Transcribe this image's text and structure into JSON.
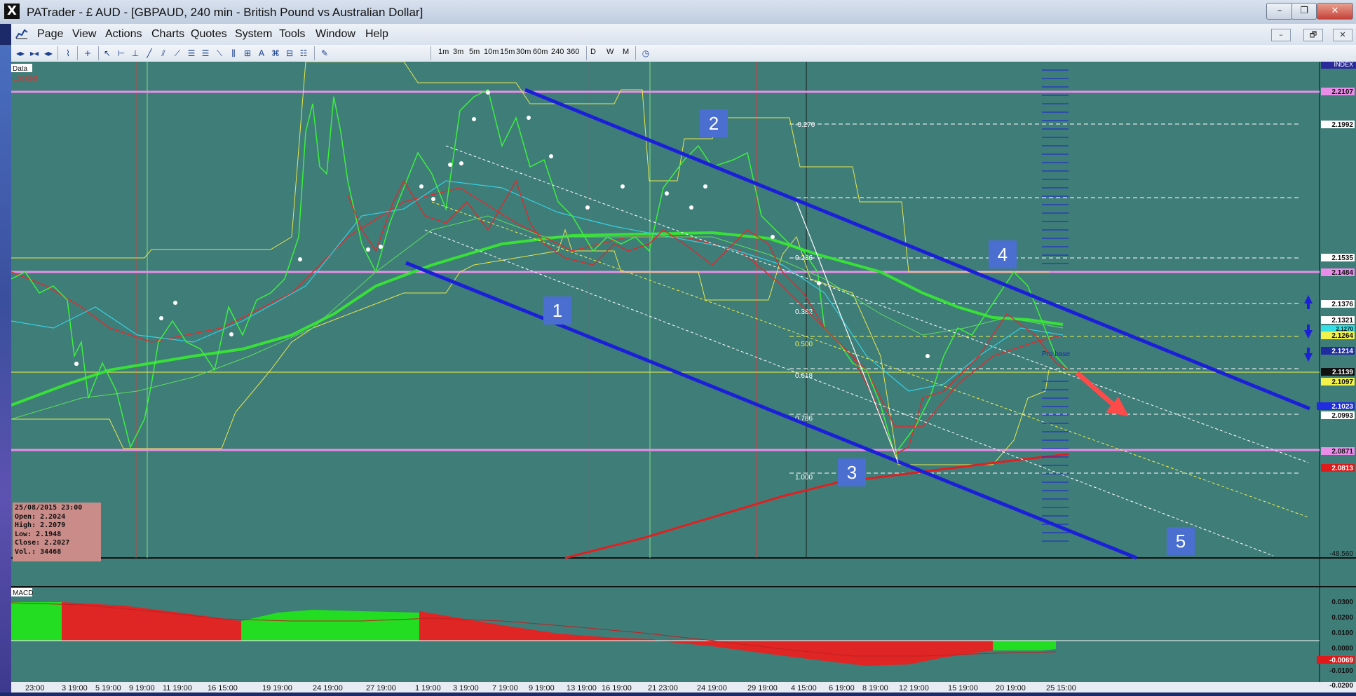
{
  "window": {
    "title": "PATrader - £ AUD - [GBPAUD, 240 min - British Pound vs Australian Dollar]",
    "app_icon": "X",
    "controls": [
      "–",
      "❐",
      "✕"
    ]
  },
  "menu": [
    "Page",
    "View",
    "Actions",
    "Charts",
    "Quotes",
    "System",
    "Tools",
    "Window",
    "Help"
  ],
  "mdi_controls": [
    "–",
    "🗗",
    "✕"
  ],
  "toolbar": {
    "timeframes": [
      "1m",
      "3m",
      "5m",
      "10m",
      "15m",
      "30m",
      "60m",
      "240",
      "360"
    ],
    "periods": [
      "D",
      "W",
      "M"
    ]
  },
  "chart": {
    "data_tag": "Data",
    "locked_tag": "Locked",
    "index_tag": "INDEX",
    "wave_labels": [
      "1",
      "2",
      "3",
      "4",
      "5"
    ],
    "fib_labels": [
      "-0.270",
      "0.236",
      "0.382",
      "0.500",
      "0.618",
      "0.786",
      "1.000"
    ],
    "arrow_text": "Pro base",
    "info": {
      "datetime": "25/08/2015 23:00",
      "open": "Open: 2.2024",
      "high": "High: 2.2079",
      "low": "Low: 2.1948",
      "close": "Close: 2.2027",
      "vol": "Vol.: 34468"
    },
    "price_axis": [
      {
        "label": "2.2107",
        "color": "#e98de8"
      },
      {
        "label": "2.1992",
        "color": "#ffffff"
      },
      {
        "label": "2.1535",
        "color": "#ffffff"
      },
      {
        "label": "2.1484",
        "color": "#e98de8"
      },
      {
        "label": "2.1376",
        "color": "#ffffff"
      },
      {
        "label": "2.1321",
        "color": "#ffffff"
      },
      {
        "label": "2.1270",
        "color": "#34e0e6"
      },
      {
        "label": "2.1264",
        "color": "#f2f24a"
      },
      {
        "label": "2.1214",
        "color": "#1f2ca0"
      },
      {
        "label": "2.1139",
        "color": "#111111"
      },
      {
        "label": "2.1097",
        "color": "#f2f24a"
      },
      {
        "label": "2.1023",
        "color": "#1f2ce0"
      },
      {
        "label": "2.0993",
        "color": "#ffffff"
      },
      {
        "label": "2.0871",
        "color": "#e98de8"
      },
      {
        "label": "2.0813",
        "color": "#e01a1a"
      }
    ],
    "lower_value": "-48.560",
    "macd_label": "MACD",
    "macd_axis": [
      "0.0300",
      "0.0200",
      "0.0100",
      "0.0000",
      "-0.0100",
      "-0.0200"
    ],
    "macd_current": "-0.0069",
    "dates": [
      "23:00",
      "3 19:00",
      "5 19:00",
      "9 19:00",
      "11 19:00",
      "16 15:00",
      "19 19:00",
      "24 19:00",
      "27 19:00",
      "1 19:00",
      "3 19:00",
      "7 19:00",
      "9 19:00",
      "13 19:00",
      "16 19:00",
      "21 23:00",
      "24 19:00",
      "29 19:00",
      "4 15:00",
      "6 19:00",
      "8 19:00",
      "12 19:00",
      "15 19:00",
      "20 19:00",
      "25 15:00"
    ]
  }
}
